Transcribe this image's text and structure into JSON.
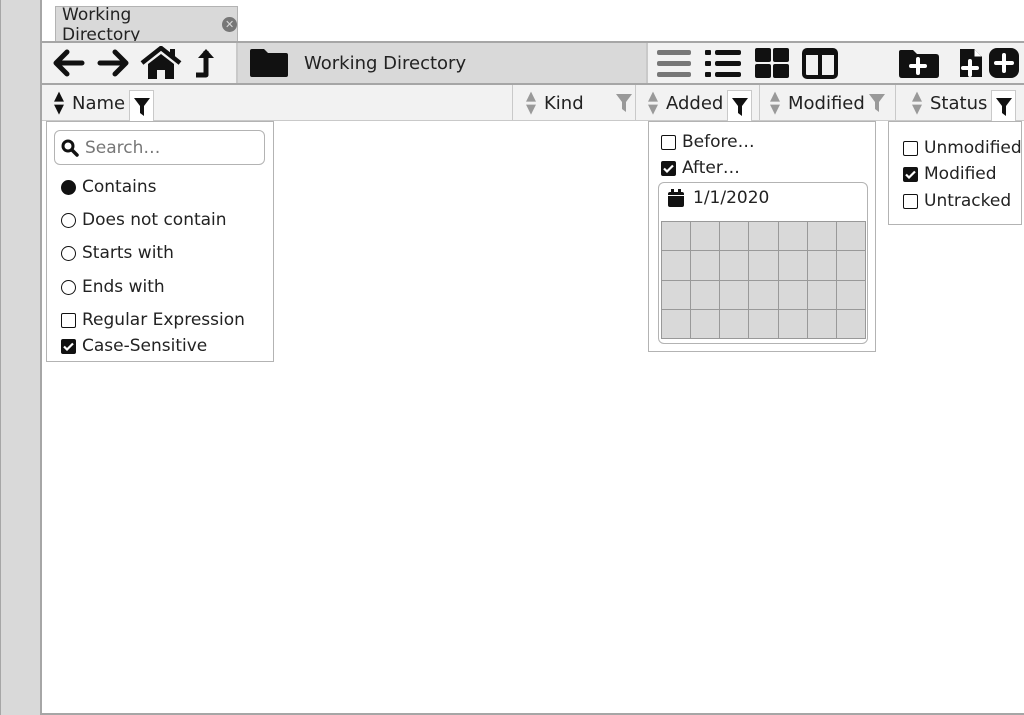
{
  "tab": {
    "title": "Working Directory",
    "close_icon": "close-circle-icon"
  },
  "toolbar": {
    "nav": [
      {
        "name": "back-button",
        "icon": "arrow-left-icon"
      },
      {
        "name": "forward-button",
        "icon": "arrow-right-icon"
      },
      {
        "name": "home-button",
        "icon": "home-icon"
      },
      {
        "name": "up-button",
        "icon": "arrow-up-icon"
      }
    ],
    "path_icon": "folder-icon",
    "path_label": "Working Directory",
    "views": [
      "list-view-icon",
      "details-view-icon",
      "grid-view-icon",
      "columns-view-icon"
    ],
    "actions": [
      "new-folder-icon",
      "new-file-icon",
      "add-icon"
    ]
  },
  "columns": [
    {
      "label": "Name",
      "filter_active": true
    },
    {
      "label": "Kind",
      "filter_active": false
    },
    {
      "label": "Added",
      "filter_active": true
    },
    {
      "label": "Modified",
      "filter_active": false
    },
    {
      "label": "Status",
      "filter_active": true
    }
  ],
  "name_filter": {
    "search_placeholder": "Search…",
    "modes": [
      {
        "label": "Contains",
        "selected": true
      },
      {
        "label": "Does not contain",
        "selected": false
      },
      {
        "label": "Starts with",
        "selected": false
      },
      {
        "label": "Ends with",
        "selected": false
      }
    ],
    "options": [
      {
        "label": "Regular Expression",
        "checked": false
      },
      {
        "label": "Case-Sensitive",
        "checked": true
      }
    ]
  },
  "added_filter": {
    "options": [
      {
        "label": "Before…",
        "checked": false
      },
      {
        "label": "After…",
        "checked": true
      }
    ],
    "date": "1/1/2020"
  },
  "status_filter": {
    "options": [
      {
        "label": "Unmodified",
        "checked": false
      },
      {
        "label": "Modified",
        "checked": true
      },
      {
        "label": "Untracked",
        "checked": false
      }
    ]
  }
}
